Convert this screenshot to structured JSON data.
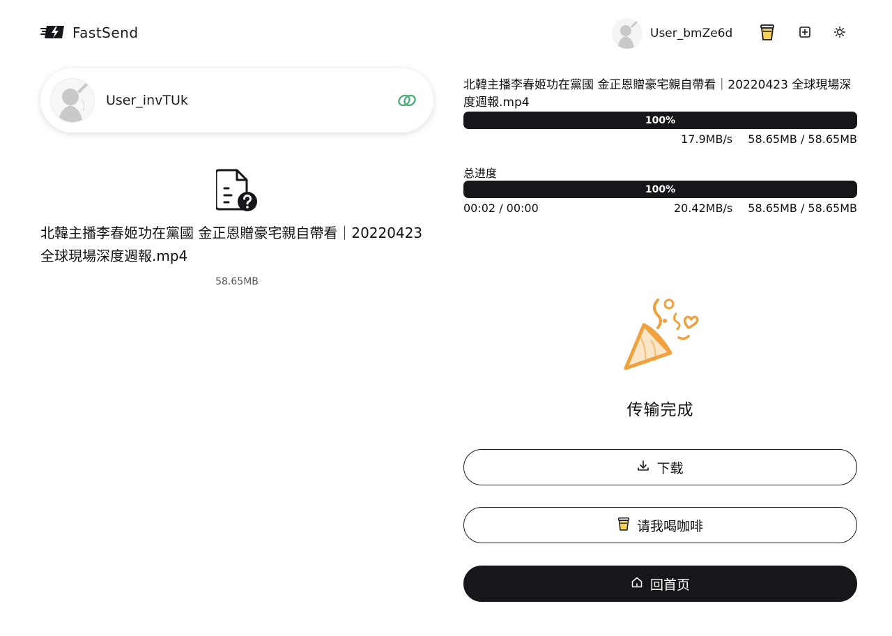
{
  "app": {
    "name": "FastSend",
    "colors": {
      "accent": "#17171b",
      "success": "#4caf7a",
      "party_orange": "#f0a03c",
      "coffee_yellow": "#f6d25c"
    }
  },
  "header": {
    "username": "User_bmZe6d",
    "icons": [
      "coffee-cup-icon",
      "layout-icon",
      "sun-icon"
    ]
  },
  "peer": {
    "username": "User_invTUk",
    "status_icon": "link-icon"
  },
  "file": {
    "name": "北韓主播李春姬功在黨國 金正恩贈豪宅親自帶看｜20220423 全球現場深度週報.mp4",
    "size": "58.65MB",
    "icon": "file-unknown-icon"
  },
  "transfer": {
    "file_name": "北韓主播李春姬功在黨國 金正恩贈豪宅親自帶看｜20220423 全球現場深度週報.mp4",
    "file_progress": {
      "percent": 100,
      "label": "100%",
      "speed": "17.9MB/s",
      "size": "58.65MB / 58.65MB"
    },
    "total_label": "总进度",
    "total_progress": {
      "percent": 100,
      "label": "100%",
      "time": "00:02 / 00:00",
      "speed": "20.42MB/s",
      "size": "58.65MB / 58.65MB"
    }
  },
  "complete": {
    "icon": "party-popper-icon",
    "text": "传输完成",
    "buttons": {
      "download": "下载",
      "coffee": "请我喝咖啡",
      "home": "回首页"
    }
  }
}
